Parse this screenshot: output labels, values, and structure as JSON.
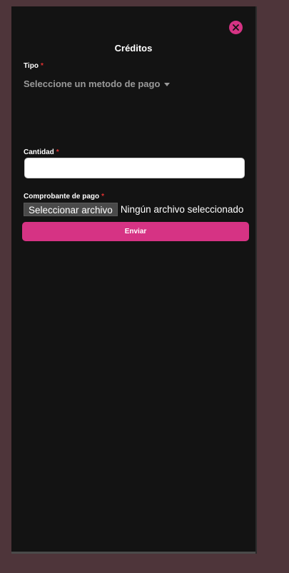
{
  "modal": {
    "title": "Créditos",
    "close_icon": "close-icon"
  },
  "form": {
    "tipo": {
      "label": "Tipo",
      "required_mark": "*",
      "select_placeholder": "Seleccione un metodo de pago"
    },
    "cantidad": {
      "label": "Cantidad",
      "required_mark": "*",
      "value": ""
    },
    "comprobante": {
      "label": "Comprobante de pago",
      "required_mark": "*",
      "button_label": "Seleccionar archivo",
      "status": "Ningún archivo seleccionado"
    },
    "submit_label": "Enviar"
  },
  "colors": {
    "accent": "#d63384",
    "modal_bg": "#131313",
    "page_bg": "#4e353a",
    "required": "#e03131"
  }
}
